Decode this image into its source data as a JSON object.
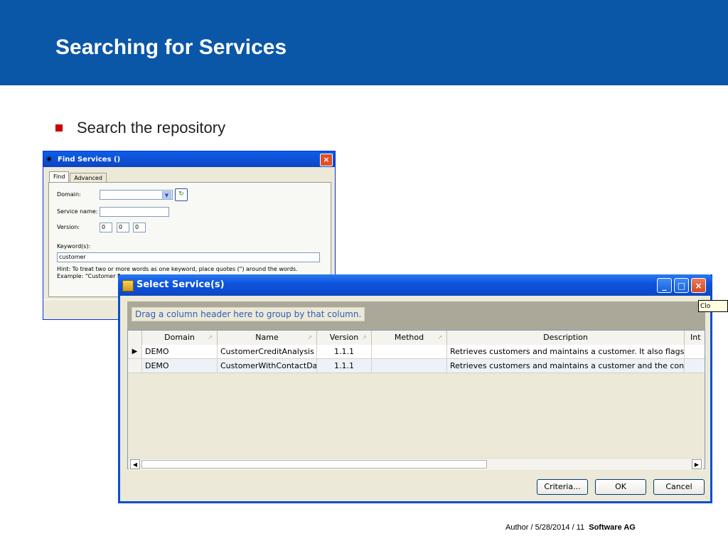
{
  "slide": {
    "title": "Searching for Services",
    "bullet": "Search the repository",
    "footer_text": "Author / 5/28/2014 / 11",
    "footer_brand": "Software AG",
    "header_color": "#0a57a8",
    "bullet_color": "#cc0000"
  },
  "find_window": {
    "title": "Find Services ()",
    "tabs": [
      "Find",
      "Advanced"
    ],
    "domain_label": "Domain:",
    "service_name_label": "Service name:",
    "version_label": "Version:",
    "version_values": [
      "0",
      "0",
      "0"
    ],
    "keywords_label": "Keyword(s):",
    "keywords_value": "customer",
    "hint_line1": "Hint: To treat two or more words as one keyword, place quotes (\") around the words.",
    "hint_line2": "Example: \"Customer Rec"
  },
  "select_window": {
    "title": "Select Service(s)",
    "close_tooltip": "Clo",
    "group_hint": "Drag a column header here to group by that column.",
    "columns": [
      "Domain",
      "Name",
      "Version",
      "Method",
      "Description",
      "Int"
    ],
    "rows": [
      {
        "domain": "DEMO",
        "name": "CustomerCreditAnalysis",
        "version": "1.1.1",
        "method": "",
        "description": "Retrieves customers and maintains a customer. It also flags"
      },
      {
        "domain": "DEMO",
        "name": "CustomerWithContactDa",
        "version": "1.1.1",
        "method": "",
        "description": "Retrieves customers and maintains a customer and the cont"
      }
    ],
    "buttons": {
      "criteria": "Criteria...",
      "ok": "OK",
      "cancel": "Cancel"
    }
  }
}
